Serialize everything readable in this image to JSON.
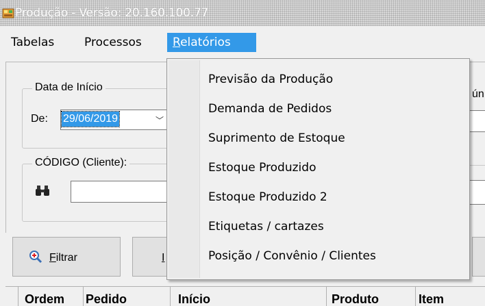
{
  "window": {
    "title": "Produção - Versão: 20.160.100.77"
  },
  "menubar": {
    "items": [
      {
        "label_pre": "",
        "accel": "",
        "label_post": "Tabelas"
      },
      {
        "label_pre": "",
        "accel": "",
        "label_post": "Processos"
      },
      {
        "label_pre": "",
        "accel": "R",
        "label_post": "elatórios"
      }
    ]
  },
  "dropdown": {
    "items": [
      "Previsão da Produção",
      "Demanda de Pedidos",
      "Suprimento de Estoque",
      "Estoque Produzido",
      "Estoque Produzido 2",
      "Etiquetas / cartazes",
      "Posição / Convênio / Clientes"
    ]
  },
  "form": {
    "date_group_label": "Data de Início",
    "from_label": "De:",
    "from_value": "29/06/2019",
    "client_group_label": "CÓDIGO (Cliente):",
    "client_value": "",
    "right_clip_text": "ún",
    "filter_button": {
      "accel": "F",
      "label": "iltrar"
    },
    "second_button_clip": "I"
  },
  "grid": {
    "columns": [
      "Ordem",
      "Pedido",
      "Início",
      "Produto",
      "Item"
    ]
  },
  "colors": {
    "highlight": "#3399e8",
    "menu_bg": "#f0f0f0"
  }
}
